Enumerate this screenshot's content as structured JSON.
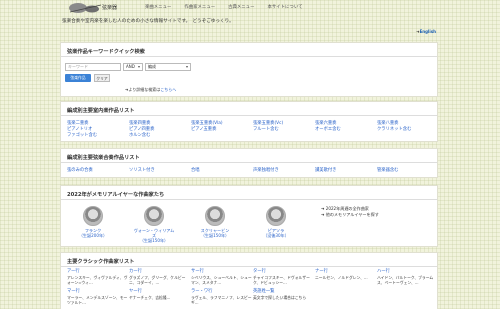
{
  "header": {
    "site_title": "弦楽器",
    "nav": [
      "楽曲メニュー",
      "作曲家メニュー",
      "古典メニュー",
      "本サイトについて"
    ],
    "tagline": "弦楽合奏や室内楽を楽しむ人のための小さな情報サイトです。　どうぞごゆっくり。",
    "english_arrow": "➜",
    "english": "English"
  },
  "search": {
    "title": "弦楽作品キーワードクイック検索",
    "placeholder": "キーワード",
    "and_select": "AND",
    "formation_select": "編成",
    "search_button": "弦楽作品",
    "clear_button": "クリア",
    "advanced_prefix": "➜より詳細な検索は",
    "advanced_link": "こちらへ"
  },
  "formation": {
    "title": "編成別主要室内楽作品リスト",
    "items": [
      "弦楽二重奏",
      "弦楽四重奏",
      "弦楽五重奏(Vla)",
      "弦楽五重奏(Vc)",
      "弦楽六重奏",
      "弦楽八重奏",
      "ピアノトリオ",
      "ピアノ四重奏",
      "ピアノ五重奏",
      "フルート含む",
      "オーボエ含む",
      "クラリネット含む",
      "ファゴット含む",
      "ホルン含む",
      "",
      "",
      "",
      ""
    ]
  },
  "piano": {
    "title": "編成別主要弦楽合奏作品リスト",
    "items": [
      "弦のみの合奏",
      "ソリスト付き",
      "合唱",
      "声楽独唱付き",
      "讃美歌付き",
      "管楽器含む"
    ]
  },
  "memorial": {
    "title": "2022年がメモリアルイヤーな作曲家たち",
    "composers": [
      {
        "name": "フランク",
        "note": "（生誕200年）"
      },
      {
        "name": "ヴォーン・ウィリアムズ",
        "note": "（生誕150年）"
      },
      {
        "name": "スクリャービン",
        "note": "（生誕150年）"
      },
      {
        "name": "ピアソラ",
        "note": "（没後30年）"
      }
    ],
    "links": [
      "➜ 2022年周遅の全作曲家",
      "➜ 他のメモリアルイヤーを探す"
    ]
  },
  "classic": {
    "title": "主要クラシック作曲家リスト",
    "cells": [
      {
        "head": "アー行",
        "names": "アレンスキー、ヴィヴァルディ、ヴォーン=ウィ…"
      },
      {
        "head": "カー行",
        "names": "グラズノフ、グリーグ、ケルビーニ、コダーイ、…"
      },
      {
        "head": "サー行",
        "names": "シベリウス、シューベルト、シューマン、スメタナ…"
      },
      {
        "head": "ター行",
        "names": "チャイコフスキー、ドヴォルザーク、ドビュッシー…"
      },
      {
        "head": "ナー行",
        "names": "ニールセン、ノルドグレン、…"
      },
      {
        "head": "ハー行",
        "names": "ハイドン、バルトーク、ブラームス、ベートーヴェン、…"
      },
      {
        "head": "マー行",
        "names": "マーラー、メンデルスゾーン、モーツァルト…"
      },
      {
        "head": "ヤー行",
        "names": "ヤナーチェク、吉松隆…"
      },
      {
        "head": "ラー・ワ行",
        "names": "ラヴェル、ラフマニノフ、レスピーギ…"
      },
      {
        "head": "英語姓一覧",
        "names": "英文字で探したい場合はこちら"
      },
      {
        "head": "",
        "names": ""
      },
      {
        "head": "",
        "names": ""
      }
    ]
  }
}
